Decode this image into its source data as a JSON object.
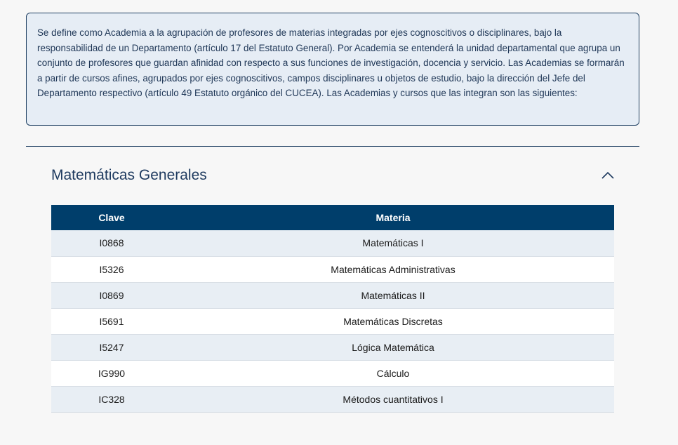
{
  "intro": {
    "text": "Se define como Academia a la agrupación de profesores de materias integradas por ejes cognoscitivos o disciplinares, bajo la responsabilidad de un Departamento (artículo 17 del Estatuto General). Por Academia se entenderá la unidad departamental que agrupa un conjunto de profesores que guardan afinidad con respecto a sus funciones de investigación, docencia y servicio. Las Academias se formarán a partir de cursos afines, agrupados por ejes cognoscitivos, campos disciplinares u objetos de estudio, bajo la dirección del Jefe del Departamento respectivo (artículo 49 Estatuto orgánico del CUCEA). Las Academias y cursos que las integran son las siguientes:"
  },
  "accordion": {
    "title": "Matemáticas Generales",
    "expanded": true,
    "toggle_icon": "chevron-up-icon"
  },
  "table": {
    "headers": {
      "clave": "Clave",
      "materia": "Materia"
    },
    "rows": [
      {
        "clave": "I0868",
        "materia": "Matemáticas I"
      },
      {
        "clave": "I5326",
        "materia": "Matemáticas Administrativas"
      },
      {
        "clave": "I0869",
        "materia": "Matemáticas II"
      },
      {
        "clave": "I5691",
        "materia": "Matemáticas Discretas"
      },
      {
        "clave": "I5247",
        "materia": "Lógica Matemática"
      },
      {
        "clave": "IG990",
        "materia": "Cálculo"
      },
      {
        "clave": "IC328",
        "materia": "Métodos cuantitativos I"
      }
    ]
  },
  "colors": {
    "header_bg": "#003e6b",
    "info_bg": "#e6edf5",
    "title_text": "#1e3a5f"
  }
}
